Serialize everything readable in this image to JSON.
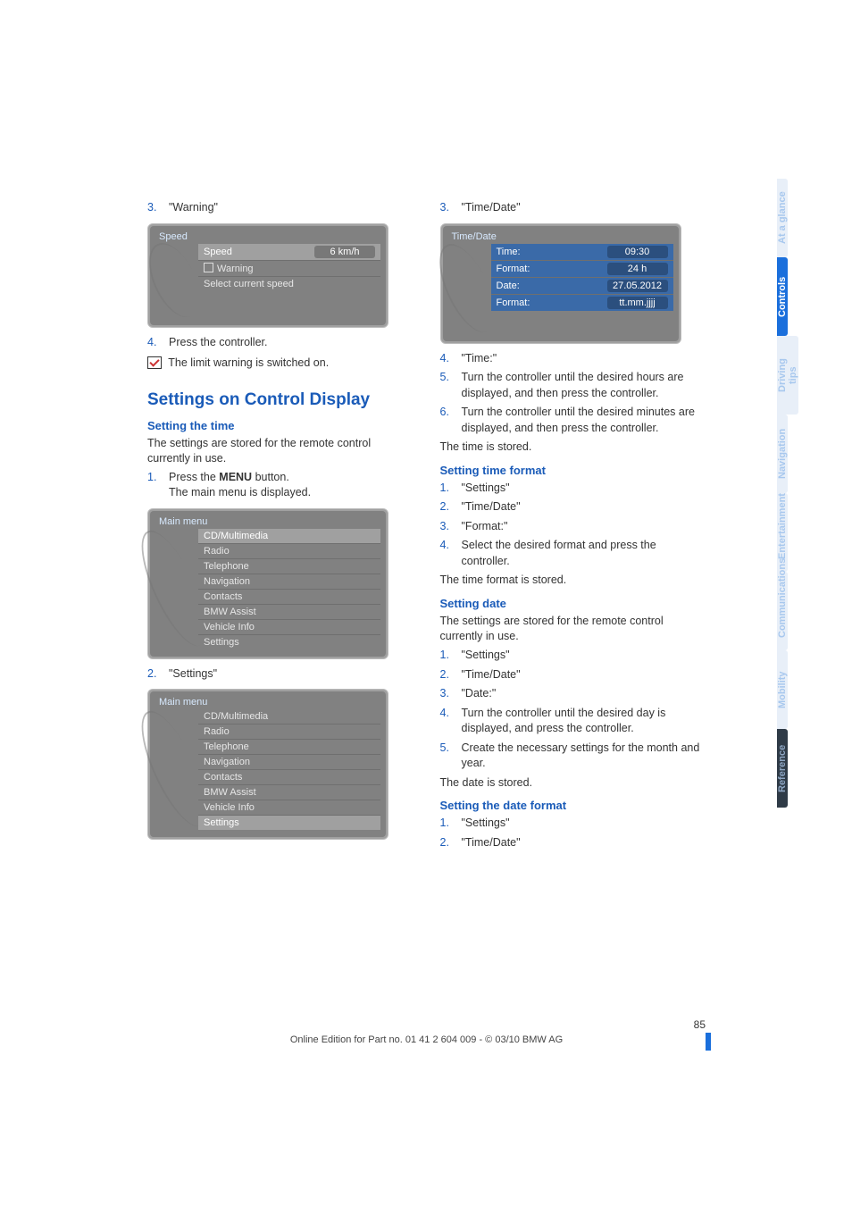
{
  "tabs": [
    "Reference",
    "Mobility",
    "Communications",
    "Entertainment",
    "Navigation",
    "Driving tips",
    "Controls",
    "At a glance"
  ],
  "active_tab": "Controls",
  "left": {
    "step3": "\"Warning\"",
    "fig_speed": {
      "title": "Speed",
      "rows": [
        {
          "label": "Speed",
          "value": "6 km/h",
          "sel": true
        },
        {
          "label": "Warning",
          "checkbox": true
        },
        {
          "label": "Select current speed"
        }
      ]
    },
    "step4": "Press the controller.",
    "checkline": "The limit warning is switched on.",
    "h1": "Settings on Control Display",
    "h2_time": "Setting the time",
    "p_time": "The settings are stored for the remote control currently in use.",
    "step1a": "Press the ",
    "step1b": " button.",
    "step1_menu": "MENU",
    "step1_sub": "The main menu is displayed.",
    "fig_main1": {
      "title": "Main menu",
      "items": [
        "CD/Multimedia",
        "Radio",
        "Telephone",
        "Navigation",
        "Contacts",
        "BMW Assist",
        "Vehicle Info",
        "Settings"
      ],
      "sel": 0
    },
    "step2": "\"Settings\"",
    "fig_main2": {
      "title": "Main menu",
      "items": [
        "CD/Multimedia",
        "Radio",
        "Telephone",
        "Navigation",
        "Contacts",
        "BMW Assist",
        "Vehicle Info",
        "Settings"
      ],
      "sel": 7
    }
  },
  "right": {
    "step3": "\"Time/Date\"",
    "fig_time": {
      "title": "Time/Date",
      "rows": [
        {
          "label": "Time:",
          "value": "09:30",
          "hl": true
        },
        {
          "label": "Format:",
          "value": "24 h"
        },
        {
          "label": "Date:",
          "value": "27.05.2012"
        },
        {
          "label": "Format:",
          "value": "tt.mm.jjjj"
        }
      ]
    },
    "step4": "\"Time:\"",
    "step5": "Turn the controller until the desired hours are displayed, and then press the controller.",
    "step6": "Turn the controller until the desired minutes are displayed, and then press the controller.",
    "p_stored": "The time is stored.",
    "h2_fmt": "Setting time format",
    "fmt_steps": [
      "\"Settings\"",
      "\"Time/Date\"",
      "\"Format:\"",
      "Select the desired format and press the controller."
    ],
    "p_fmt_stored": "The time format is stored.",
    "h2_date": "Setting date",
    "p_date": "The settings are stored for the remote control currently in use.",
    "date_steps": [
      "\"Settings\"",
      "\"Time/Date\"",
      "\"Date:\"",
      "Turn the controller until the desired day is displayed, and press the controller.",
      "Create the necessary settings for the month and year."
    ],
    "p_date_stored": "The date is stored.",
    "h2_datefmt": "Setting the date format",
    "datefmt_steps": [
      "\"Settings\"",
      "\"Time/Date\""
    ]
  },
  "page_number": "85",
  "footer": "Online Edition for Part no. 01 41 2 604 009 - © 03/10 BMW AG"
}
